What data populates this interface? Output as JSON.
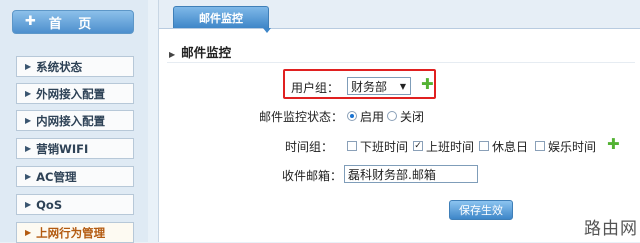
{
  "sidebar": {
    "home_label": "首 页",
    "home_icon": "plus-icon",
    "items": [
      {
        "label": "系统状态"
      },
      {
        "label": "外网接入配置"
      },
      {
        "label": "内网接入配置"
      },
      {
        "label": "营销WIFI"
      },
      {
        "label": "AC管理"
      },
      {
        "label": "QoS"
      },
      {
        "label": "上网行为管理",
        "active": true
      }
    ]
  },
  "main": {
    "tab_label": "邮件监控",
    "section_title": "邮件监控",
    "form": {
      "user_group_label": "用户组：",
      "user_group_value": "财务部",
      "monitor_status_label": "邮件监控状态：",
      "status_options": [
        "启用",
        "关闭"
      ],
      "status_selected": "启用",
      "time_group_label": "时间组：",
      "time_options": [
        {
          "label": "下班时间",
          "checked": false
        },
        {
          "label": "上班时间",
          "checked": true
        },
        {
          "label": "休息日",
          "checked": false
        },
        {
          "label": "娱乐时间",
          "checked": false
        }
      ],
      "mailbox_label": "收件邮箱：",
      "mailbox_value": "磊科财务部.邮箱",
      "save_label": "保存生效"
    }
  },
  "watermark": "路由网",
  "colors": {
    "accent": "#3e86c8",
    "highlight": "#e02020",
    "add": "#53b233",
    "active_text": "#b35a10"
  }
}
